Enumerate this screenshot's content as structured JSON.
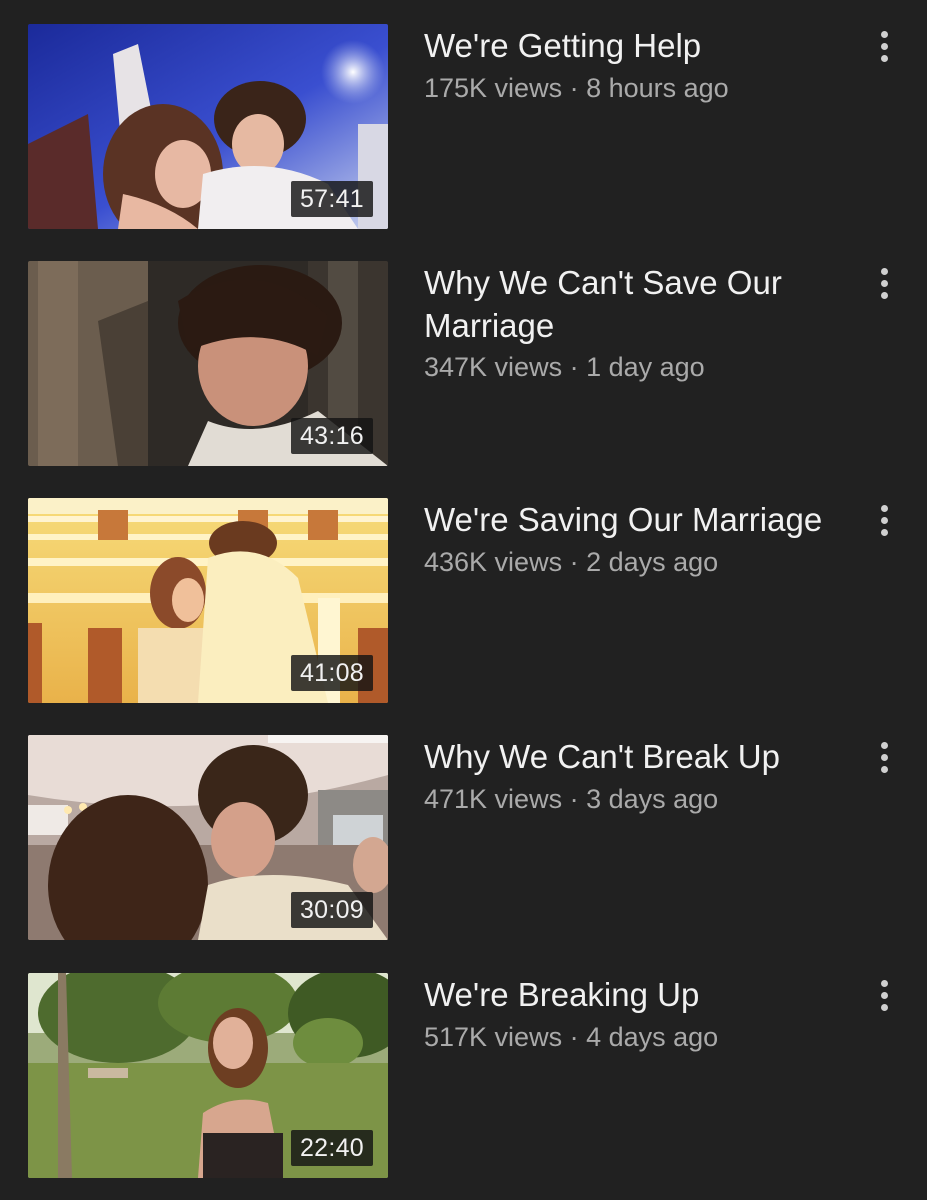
{
  "videos": [
    {
      "title": "We're Getting Help",
      "views": "175K views",
      "age": "8 hours ago",
      "duration": "57:41",
      "thumbnail_scene": "couple-night-sky"
    },
    {
      "title": "Why We Can't Save Our Marriage",
      "views": "347K views",
      "age": "1 day ago",
      "duration": "43:16",
      "thumbnail_scene": "man-doorway-closeup"
    },
    {
      "title": "We're Saving Our Marriage",
      "views": "436K views",
      "age": "2 days ago",
      "duration": "41:08",
      "thumbnail_scene": "couple-yellow-mansion"
    },
    {
      "title": "Why We Can't Break Up",
      "views": "471K views",
      "age": "3 days ago",
      "duration": "30:09",
      "thumbnail_scene": "couple-kiss-chandelier"
    },
    {
      "title": "We're Breaking Up",
      "views": "517K views",
      "age": "4 days ago",
      "duration": "22:40",
      "thumbnail_scene": "woman-park"
    }
  ],
  "separator": " · ",
  "colors": {
    "background": "#212121",
    "title": "#f1f1f1",
    "meta": "#aaaaaa"
  },
  "icons": {
    "menu": "more-vert-icon"
  }
}
